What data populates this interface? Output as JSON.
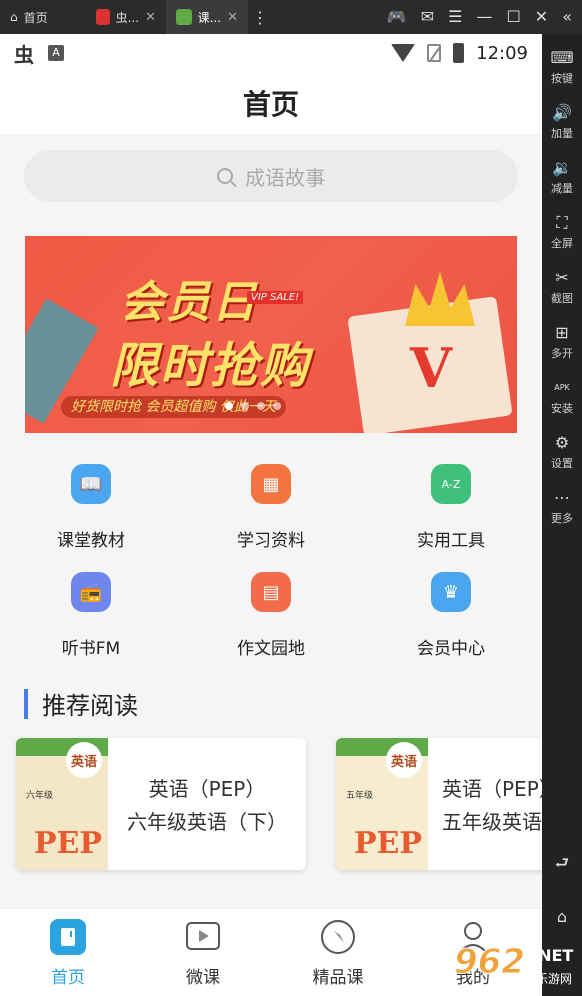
{
  "emulator": {
    "tabs": [
      {
        "label": "首页"
      },
      {
        "label": "虫..."
      },
      {
        "label": "课..."
      }
    ],
    "side_panel": [
      {
        "label": "按键",
        "icon": "keyboard-icon"
      },
      {
        "label": "加量",
        "icon": "volume-up-icon"
      },
      {
        "label": "减量",
        "icon": "volume-down-icon"
      },
      {
        "label": "全屏",
        "icon": "fullscreen-icon"
      },
      {
        "label": "截图",
        "icon": "scissors-icon"
      },
      {
        "label": "多开",
        "icon": "multi-open-icon"
      },
      {
        "label": "安装",
        "icon": "apk-install-icon"
      },
      {
        "label": "设置",
        "icon": "gear-icon"
      },
      {
        "label": "更多",
        "icon": "more-icon"
      }
    ],
    "apk_label": "APK"
  },
  "statusbar": {
    "time": "12:09",
    "notif_letter": "A"
  },
  "header": {
    "title": "首页"
  },
  "search": {
    "placeholder": "成语故事"
  },
  "banner": {
    "title1": "会员日",
    "title2": "限时抢购",
    "vip_tag": "VIP SALE!",
    "subtitle": "好货限时抢 会员超值购 仅此一天",
    "logo_letter": "V",
    "dots": 4,
    "active_dot": 0
  },
  "grid": [
    {
      "label": "课堂教材",
      "icon": "book-open-icon",
      "color": "#4aa6ef"
    },
    {
      "label": "学习资料",
      "icon": "calendar-icon",
      "color": "#f2743f"
    },
    {
      "label": "实用工具",
      "icon": "az-tool-icon",
      "color": "#3fc07a"
    },
    {
      "label": "听书FM",
      "icon": "radio-icon",
      "color": "#6f86ee"
    },
    {
      "label": "作文园地",
      "icon": "document-icon",
      "color": "#f26b4a"
    },
    {
      "label": "会员中心",
      "icon": "crown-icon",
      "color": "#4aa6ef"
    }
  ],
  "recommend": {
    "title": "推荐阅读",
    "items": [
      {
        "line1": "英语（PEP）",
        "line2": "六年级英语（下）",
        "cover_name": "英语",
        "cover_grade": "六年级",
        "cover_pep": "PEP"
      },
      {
        "line1": "英语（PEP）",
        "line2": "五年级英语（下）",
        "cover_name": "英语",
        "cover_grade": "五年级",
        "cover_pep": "PEP"
      }
    ]
  },
  "tabbar": [
    {
      "label": "首页",
      "icon": "home-icon",
      "active": true
    },
    {
      "label": "微课",
      "icon": "video-play-icon",
      "active": false
    },
    {
      "label": "精品课",
      "icon": "compass-icon",
      "active": false
    },
    {
      "label": "我的",
      "icon": "user-icon",
      "active": false
    }
  ],
  "watermark": {
    "brand": "962",
    "net": ".NET",
    "cn": "乐游网"
  },
  "colors": {
    "accent": "#2aa3e0",
    "section_bar": "#4a7de8",
    "banner_red": "#f0604d"
  }
}
